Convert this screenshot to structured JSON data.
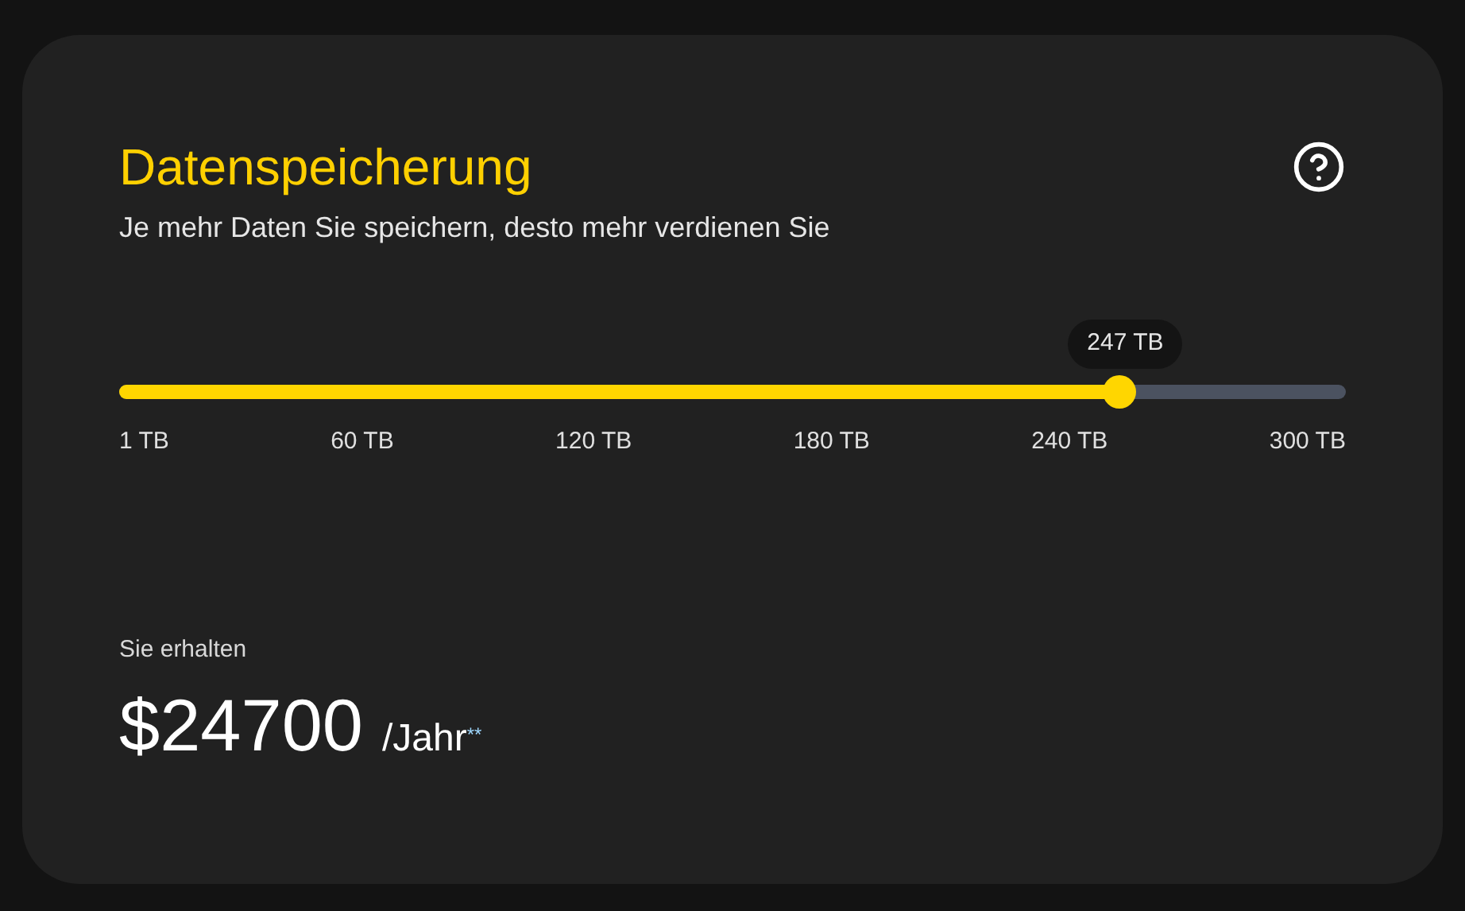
{
  "card": {
    "title": "Datenspeicherung",
    "subtitle": "Je mehr Daten Sie speichern, desto mehr verdienen Sie"
  },
  "slider": {
    "level": 0.815,
    "value_label": "247 TB",
    "ticks": [
      "1 TB",
      "60 TB",
      "120 TB",
      "180 TB",
      "240 TB",
      "300 TB"
    ]
  },
  "earnings": {
    "label": "Sie erhalten",
    "amount": "$24700",
    "period": "/Jahr$^{**}$"
  }
}
